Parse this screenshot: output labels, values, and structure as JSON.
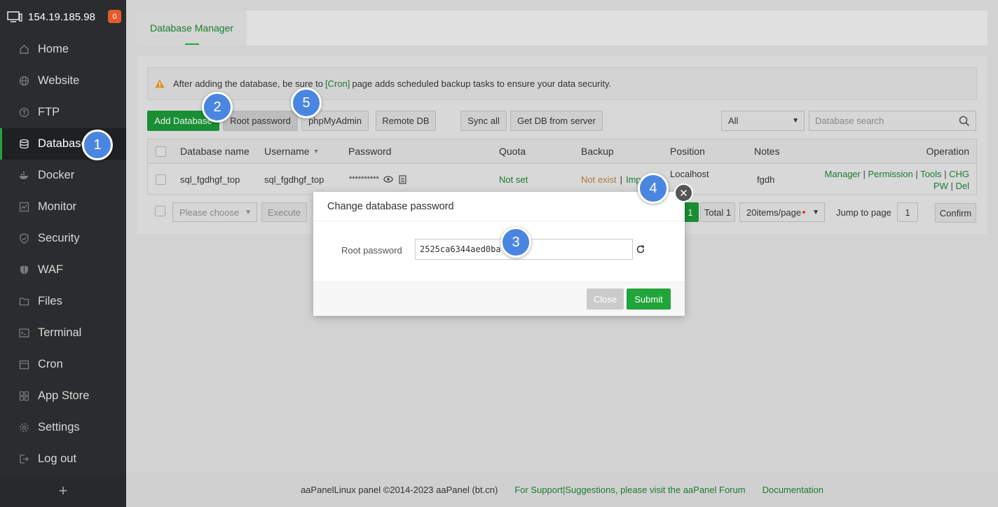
{
  "sidebar": {
    "server_ip": "154.19.185.98",
    "badge_count": "0",
    "items": [
      {
        "label": "Home",
        "icon": "home-icon"
      },
      {
        "label": "Website",
        "icon": "globe-icon"
      },
      {
        "label": "FTP",
        "icon": "ftp-icon"
      },
      {
        "label": "Databases",
        "icon": "database-icon",
        "active": true
      },
      {
        "label": "Docker",
        "icon": "docker-icon"
      },
      {
        "label": "Monitor",
        "icon": "monitor-icon"
      },
      {
        "label": "Security",
        "icon": "shield-icon"
      },
      {
        "label": "WAF",
        "icon": "waf-shield-icon"
      },
      {
        "label": "Files",
        "icon": "folder-icon"
      },
      {
        "label": "Terminal",
        "icon": "terminal-icon"
      },
      {
        "label": "Cron",
        "icon": "calendar-icon"
      },
      {
        "label": "App Store",
        "icon": "grid-icon"
      },
      {
        "label": "Settings",
        "icon": "gear-icon"
      },
      {
        "label": "Log out",
        "icon": "logout-icon"
      }
    ],
    "add_label": "+"
  },
  "tabs": {
    "active": "Database Manager"
  },
  "alert": {
    "prefix": "After adding the database, be sure to",
    "link": "[Cron]",
    "suffix": "page adds scheduled backup tasks to ensure your data security."
  },
  "toolbar": {
    "add_database": "Add Database",
    "root_password": "Root password",
    "phpmyadmin": "phpMyAdmin",
    "remote_db": "Remote DB",
    "sync_all": "Sync all",
    "get_db": "Get DB from server",
    "filter_value": "All",
    "search_placeholder": "Database search"
  },
  "table": {
    "headers": {
      "name": "Database name",
      "username": "Username",
      "password": "Password",
      "quota": "Quota",
      "backup": "Backup",
      "position": "Position",
      "notes": "Notes",
      "operation": "Operation"
    },
    "rows": [
      {
        "name": "sql_fgdhgf_top",
        "username": "sql_fgdhgf_top",
        "password": "**********",
        "quota": "Not set",
        "backup_status": "Not exist",
        "backup_sep": "|",
        "backup_import": "Imp",
        "position": "Localhost",
        "notes": "fgdh",
        "ops": [
          "Manager",
          "Permission",
          "Tools",
          "CHG PW",
          "Del"
        ]
      }
    ]
  },
  "bottom": {
    "batch_placeholder": "Please choose",
    "execute": "Execute",
    "page": "1",
    "total": "Total 1",
    "per_page": "20items/page",
    "jump_label": "Jump to page",
    "jump_value": "1",
    "confirm": "Confirm"
  },
  "modal": {
    "title": "Change database password",
    "field_label": "Root password",
    "field_value": "2525ca6344aed0ba",
    "close": "Close",
    "submit": "Submit"
  },
  "markers": [
    "1",
    "2",
    "3",
    "4",
    "5"
  ],
  "footer": {
    "copyright": "aaPanelLinux panel ©2014-2023 aaPanel (bt.cn)",
    "support": "For Support|Suggestions, please visit the aaPanel Forum",
    "docs": "Documentation"
  },
  "colors": {
    "accent": "#20a53a",
    "sidebar_bg": "#2a2c2e",
    "marker": "#4a86e0",
    "badge": "#e4592b"
  }
}
